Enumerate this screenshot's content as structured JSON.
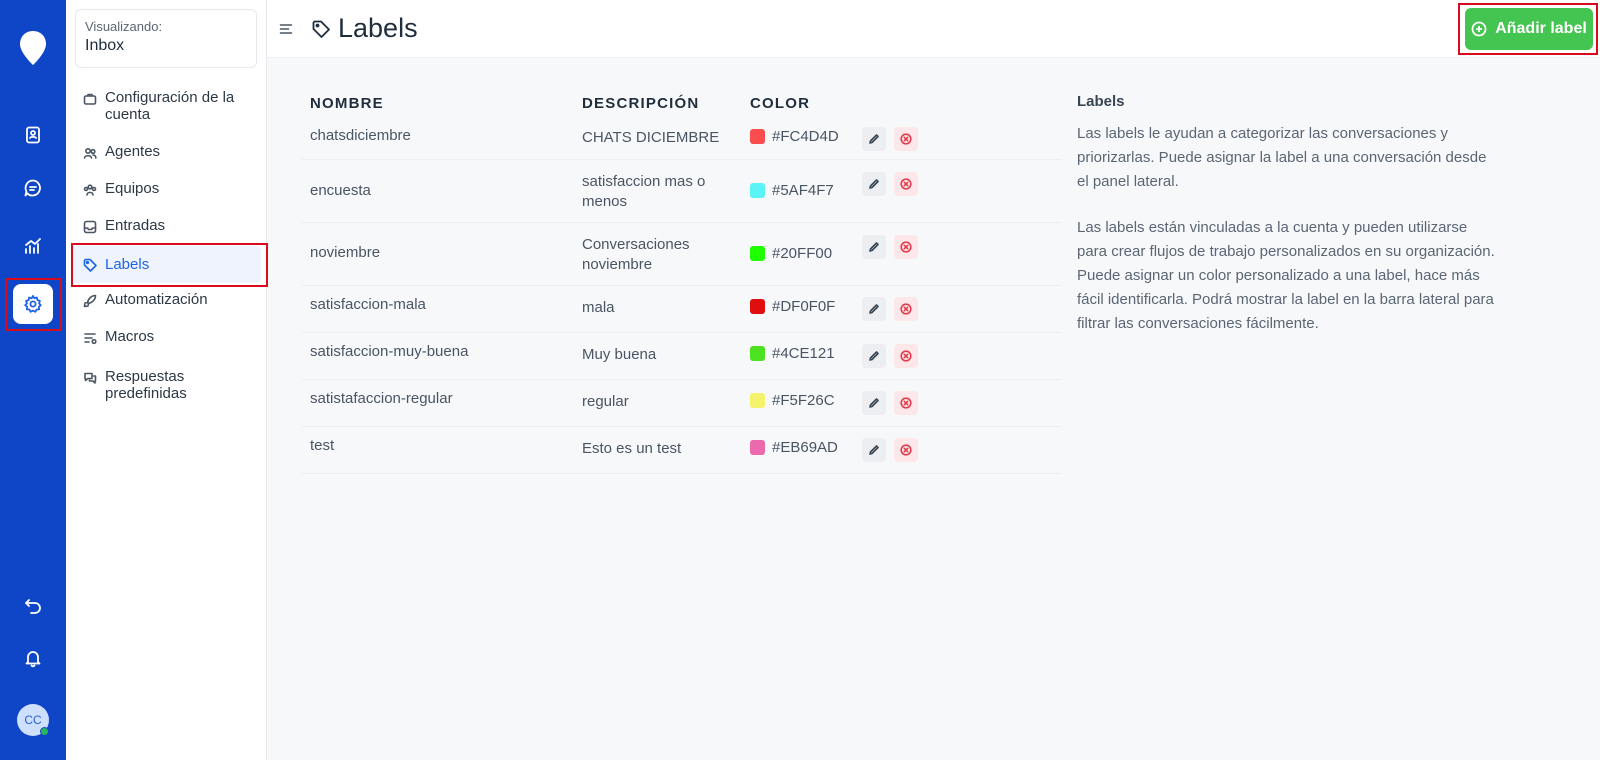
{
  "rail": {
    "items": [
      {
        "name": "contacts",
        "icon": "contact-book-icon"
      },
      {
        "name": "conversations",
        "icon": "chat-bubble-icon"
      },
      {
        "name": "reports",
        "icon": "chart-line-icon"
      },
      {
        "name": "settings",
        "icon": "gear-icon",
        "active": true
      }
    ],
    "bottom_items": [
      {
        "name": "back",
        "icon": "undo-icon"
      },
      {
        "name": "notifications",
        "icon": "bell-icon"
      }
    ],
    "avatar_initials": "CC"
  },
  "sidebar": {
    "viewing_caption": "Visualizando:",
    "viewing_value": "Inbox",
    "items": [
      {
        "label": "Configuración de la cuenta",
        "icon": "briefcase-icon"
      },
      {
        "label": "Agentes",
        "icon": "people-icon"
      },
      {
        "label": "Equipos",
        "icon": "team-icon"
      },
      {
        "label": "Entradas",
        "icon": "inbox-icon"
      },
      {
        "label": "Labels",
        "icon": "tag-icon",
        "active": true
      },
      {
        "label": "Automatización",
        "icon": "rocket-icon"
      },
      {
        "label": "Macros",
        "icon": "macro-icon"
      },
      {
        "label": "Respuestas predefinidas",
        "icon": "chat-multiple-icon"
      }
    ]
  },
  "header": {
    "title": "Labels",
    "add_button_label": "Añadir label"
  },
  "table": {
    "headers": {
      "name": "NOMBRE",
      "description": "DESCRIPCIÓN",
      "color": "COLOR"
    },
    "rows": [
      {
        "name": "chatsdiciembre",
        "description": "CHATS DICIEMBRE",
        "color": "#FC4D4D"
      },
      {
        "name": "encuesta",
        "description": "satisfaccion mas o menos",
        "color": "#5AF4F7"
      },
      {
        "name": "noviembre",
        "description": "Conversaciones noviembre",
        "color": "#20FF00"
      },
      {
        "name": "satisfaccion-mala",
        "description": "mala",
        "color": "#DF0F0F"
      },
      {
        "name": "satisfaccion-muy-buena",
        "description": "Muy buena",
        "color": "#4CE121"
      },
      {
        "name": "satistafaccion-regular",
        "description": "regular",
        "color": "#F5F26C"
      },
      {
        "name": "test",
        "description": "Esto es un test",
        "color": "#EB69AD"
      }
    ]
  },
  "info": {
    "title": "Labels",
    "paragraph1": "Las labels le ayudan a categorizar las conversaciones y priorizarlas. Puede asignar la label a una conversación desde el panel lateral.",
    "paragraph2": "Las labels están vinculadas a la cuenta y pueden utilizarse para crear flujos de trabajo personalizados en su organización. Puede asignar un color personalizado a una label, hace más fácil identificarla. Podrá mostrar la label en la barra lateral para filtrar las conversaciones fácilmente."
  },
  "colors": {
    "rail_bg": "#0F46C8",
    "accent": "#1F64E6",
    "add_button": "#44C451",
    "highlight": "#D90C1E"
  }
}
